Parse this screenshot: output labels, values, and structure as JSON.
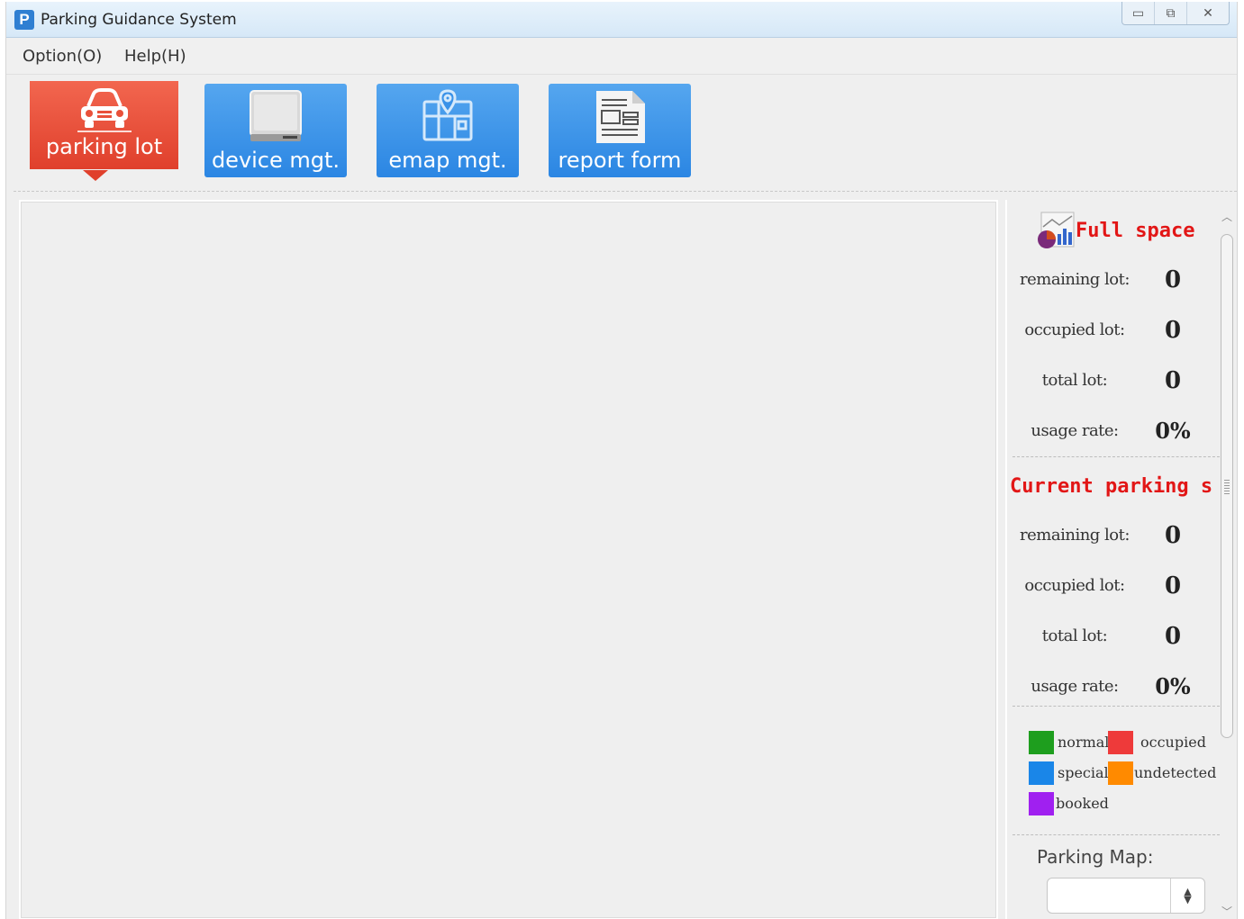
{
  "window": {
    "title": "Parking Guidance System",
    "app_icon_letter": "P",
    "controls": {
      "minimize": "▭",
      "restore": "⧉",
      "close": "✕"
    }
  },
  "menu": [
    {
      "label": "Option(O)"
    },
    {
      "label": "Help(H)"
    }
  ],
  "toolbar": [
    {
      "label": "parking lot",
      "icon": "car-icon",
      "active": true
    },
    {
      "label": "device mgt.",
      "icon": "monitor-icon",
      "active": false
    },
    {
      "label": "emap mgt.",
      "icon": "map-pin-icon",
      "active": false
    },
    {
      "label": "report form",
      "icon": "document-icon",
      "active": false
    }
  ],
  "colors": {
    "active_tab": "#e0402c",
    "tab": "#2b86e3",
    "section_title": "#e21616"
  },
  "full_space": {
    "title": "Full  space",
    "icon": "chart-icon",
    "stats": [
      {
        "label": "remaining lot:",
        "value": "0"
      },
      {
        "label": "occupied lot:",
        "value": "0"
      },
      {
        "label": "total lot:",
        "value": "0"
      },
      {
        "label": "usage rate:",
        "value": "0%"
      }
    ]
  },
  "current_parking": {
    "title": "Current parking s",
    "stats": [
      {
        "label": "remaining lot:",
        "value": "0"
      },
      {
        "label": "occupied lot:",
        "value": "0"
      },
      {
        "label": "total lot:",
        "value": "0"
      },
      {
        "label": "usage rate:",
        "value": "0%"
      }
    ]
  },
  "legend": [
    {
      "label": "normal",
      "color": "#1e9e1e"
    },
    {
      "label": "occupied",
      "color": "#ee3a3a"
    },
    {
      "label": "special",
      "color": "#1a86e8"
    },
    {
      "label": "undetected",
      "color": "#ff8a00"
    },
    {
      "label": "booked",
      "color": "#a020f0"
    }
  ],
  "parking_map": {
    "label": "Parking Map:",
    "selected": ""
  }
}
